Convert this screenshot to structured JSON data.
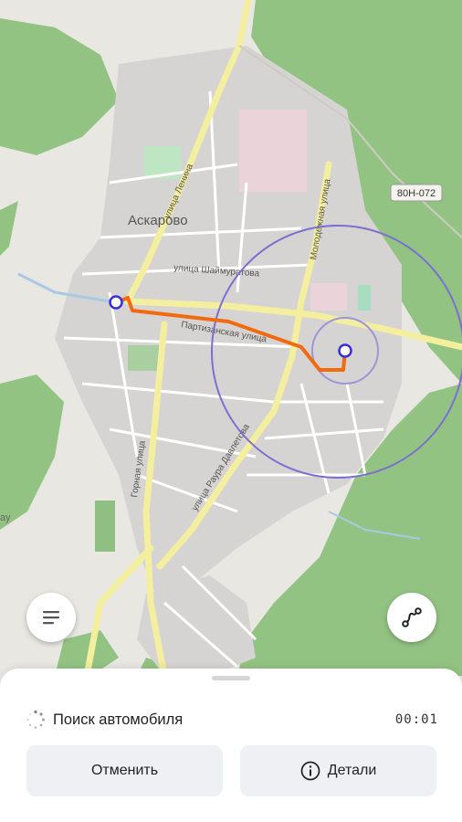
{
  "map": {
    "place_label": "Аскарово",
    "road_badge": "80Н-072",
    "edge_label": "ау",
    "streets": {
      "lenina": "улица Ленина",
      "shaimuratova": "улица Шаймуратова",
      "partizanskaya": "Партизанская улица",
      "molodezhnaya": "Молодежная улица",
      "gornaya": "Горная улица",
      "daveltov": "улица Раура Давлетова"
    },
    "colors": {
      "route": "#f26a10",
      "accuracy_circle": "#7b6fd0",
      "marker": "#3b2fd6",
      "forest": "#8fc07f",
      "road": "#f4f0a8"
    }
  },
  "buttons": {
    "menu_icon": "list-icon",
    "route_icon": "route-icon"
  },
  "sheet": {
    "status_text": "Поиск автомобиля",
    "timer": "00:01",
    "cancel_label": "Отменить",
    "details_label": "Детали",
    "details_icon": "info-icon"
  }
}
